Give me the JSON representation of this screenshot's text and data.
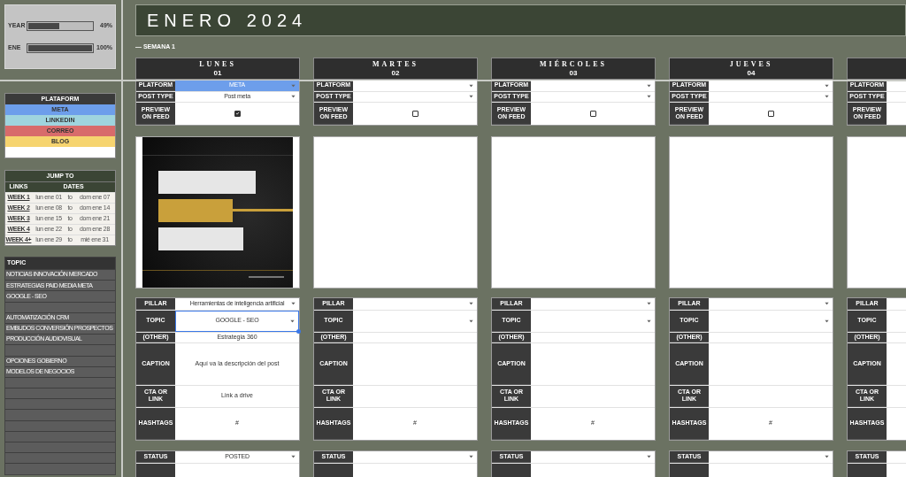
{
  "progress": [
    {
      "label": "YEAR",
      "level": 0.49,
      "reading": "49%"
    },
    {
      "label": "ENE",
      "level": 1,
      "reading": "100%"
    }
  ],
  "platform_legend": {
    "title": "PLATAFORM",
    "items": [
      {
        "label": "META",
        "color": "#6d9eeb"
      },
      {
        "label": "LINKEDIN",
        "color": "#9fd4de"
      },
      {
        "label": "CORREO",
        "color": "#d86b6b"
      },
      {
        "label": "BLOG",
        "color": "#f6d46f"
      }
    ]
  },
  "jump_to": {
    "title": "JUMP TO",
    "columns": [
      "LINKS",
      "DATES"
    ],
    "rows": [
      {
        "link": "WEEK 1",
        "start": "lun ene 01",
        "to": "to",
        "end": "dom ene 07"
      },
      {
        "link": "WEEK 2",
        "start": "lun ene 08",
        "to": "to",
        "end": "dom ene 14"
      },
      {
        "link": "WEEK 3",
        "start": "lun ene 15",
        "to": "to",
        "end": "dom ene 21"
      },
      {
        "link": "WEEK 4",
        "start": "lun ene 22",
        "to": "to",
        "end": "dom ene 28"
      },
      {
        "link": "WEEK 4+",
        "start": "lun ene 29",
        "to": "to",
        "end": "mié ene 31"
      }
    ]
  },
  "topics": {
    "title": "TOPIC",
    "items": [
      {
        "kind": "topic",
        "label": "NOTICIAS INNOVACIÓN MERCADO"
      },
      {
        "kind": "topic",
        "label": "ESTRATEGIAS PAID MEDIA META"
      },
      {
        "kind": "topic",
        "label": "GOOGLE - SEO"
      },
      {
        "kind": "blank"
      },
      {
        "kind": "topic",
        "label": "AUTOMATIZACIÓN CRM"
      },
      {
        "kind": "topic",
        "label": "EMBUDOS CONVERSIÓN PROSPECTOS"
      },
      {
        "kind": "topic",
        "label": "PRODUCCIÓN AUDIOVISUAL"
      },
      {
        "kind": "blank"
      },
      {
        "kind": "topic",
        "label": "OPCIONES GOBIERNO"
      },
      {
        "kind": "topic",
        "label": "MODELOS DE NEGOCIOS"
      },
      {
        "kind": "blank"
      },
      {
        "kind": "blank"
      },
      {
        "kind": "blank"
      },
      {
        "kind": "blank"
      },
      {
        "kind": "blank"
      },
      {
        "kind": "blank"
      },
      {
        "kind": "blank"
      },
      {
        "kind": "blank"
      },
      {
        "kind": "blank"
      }
    ]
  },
  "title": "ENERO 2024",
  "week": "— SEMANA 1",
  "days": [
    {
      "name": "LUNES",
      "number": "01",
      "image": {
        "kind": "picture"
      },
      "top_rows": [
        {
          "kind": "dropdown",
          "label": "PLATFORM",
          "value": "META",
          "color": "#6d9eeb"
        },
        {
          "kind": "dropdown",
          "label": "POST TYPE",
          "value": "Post meta"
        },
        {
          "kind": "checkbox",
          "label": "PREVIEW ON FEED",
          "checked": true
        }
      ],
      "bottom_rows": [
        {
          "kind": "dropdown",
          "label": "PILLAR",
          "value": "Herramientas de inteligencia artificial"
        },
        {
          "kind": "dropdown",
          "label": "TOPIC",
          "value": "GOOGLE - SEO",
          "selected": true
        },
        {
          "kind": "text",
          "label": "(OTHER)",
          "value": "Estrategia 360"
        },
        {
          "kind": "text",
          "label": "CAPTION",
          "value": "Aquí va la descripción del post"
        },
        {
          "kind": "text",
          "label": "CTA OR LINK",
          "value": "Link a drive"
        },
        {
          "kind": "text",
          "label": "HASHTAGS",
          "value": "#"
        }
      ],
      "status_rows": [
        {
          "kind": "dropdown",
          "label": "STATUS",
          "value": "POSTED"
        }
      ]
    },
    {
      "name": "MARTES",
      "number": "02",
      "top_rows": [
        {
          "kind": "dropdown",
          "label": "PLATFORM"
        },
        {
          "kind": "dropdown",
          "label": "POST TYPE"
        },
        {
          "kind": "checkbox",
          "label": "PREVIEW ON FEED",
          "checked": false
        }
      ],
      "bottom_rows": [
        {
          "kind": "dropdown",
          "label": "PILLAR"
        },
        {
          "kind": "dropdown",
          "label": "TOPIC",
          "selected": false
        },
        {
          "kind": "text",
          "label": "(OTHER)"
        },
        {
          "kind": "text",
          "label": "CAPTION"
        },
        {
          "kind": "text",
          "label": "CTA OR LINK"
        },
        {
          "kind": "text",
          "label": "HASHTAGS",
          "value": "#"
        }
      ],
      "status_rows": [
        {
          "kind": "dropdown",
          "label": "STATUS"
        }
      ]
    },
    {
      "name": "MIÉRCOLES",
      "number": "03",
      "top_rows": [
        {
          "kind": "dropdown",
          "label": "PLATFORM"
        },
        {
          "kind": "dropdown",
          "label": "POST TYPE"
        },
        {
          "kind": "checkbox",
          "label": "PREVIEW ON FEED",
          "checked": false
        }
      ],
      "bottom_rows": [
        {
          "kind": "dropdown",
          "label": "PILLAR"
        },
        {
          "kind": "dropdown",
          "label": "TOPIC",
          "selected": false
        },
        {
          "kind": "text",
          "label": "(OTHER)"
        },
        {
          "kind": "text",
          "label": "CAPTION"
        },
        {
          "kind": "text",
          "label": "CTA OR LINK"
        },
        {
          "kind": "text",
          "label": "HASHTAGS",
          "value": "#"
        }
      ],
      "status_rows": [
        {
          "kind": "dropdown",
          "label": "STATUS"
        }
      ]
    },
    {
      "name": "JUEVES",
      "number": "04",
      "top_rows": [
        {
          "kind": "dropdown",
          "label": "PLATFORM"
        },
        {
          "kind": "dropdown",
          "label": "POST TYPE"
        },
        {
          "kind": "checkbox",
          "label": "PREVIEW ON FEED",
          "checked": false
        }
      ],
      "bottom_rows": [
        {
          "kind": "dropdown",
          "label": "PILLAR"
        },
        {
          "kind": "dropdown",
          "label": "TOPIC",
          "selected": false
        },
        {
          "kind": "text",
          "label": "(OTHER)"
        },
        {
          "kind": "text",
          "label": "CAPTION"
        },
        {
          "kind": "text",
          "label": "CTA OR LINK"
        },
        {
          "kind": "text",
          "label": "HASHTAGS",
          "value": "#"
        }
      ],
      "status_rows": [
        {
          "kind": "dropdown",
          "label": "STATUS"
        }
      ]
    },
    {
      "top_rows": [
        {
          "kind": "cell",
          "label": "PLATFORM"
        },
        {
          "kind": "cell",
          "label": "POST TYPE"
        },
        {
          "kind": "cell",
          "label": "PREVIEW ON FEED"
        }
      ],
      "bottom_rows": [
        {
          "kind": "cell",
          "label": "PILLAR"
        },
        {
          "kind": "cell",
          "label": "TOPIC"
        },
        {
          "kind": "cell",
          "label": "(OTHER)"
        },
        {
          "kind": "cell",
          "label": "CAPTION"
        },
        {
          "kind": "cell",
          "label": "CTA OR LINK"
        },
        {
          "kind": "cell",
          "label": "HASHTAGS"
        }
      ],
      "status_rows": [
        {
          "kind": "cell",
          "label": "STATUS"
        }
      ]
    }
  ]
}
